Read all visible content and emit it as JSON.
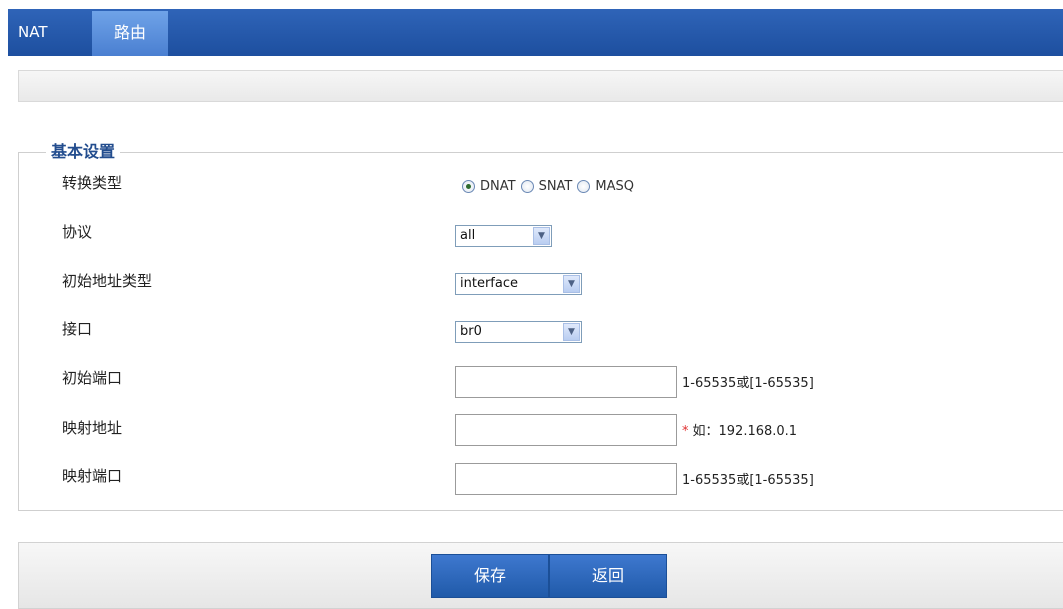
{
  "tabs": [
    {
      "label": "NAT",
      "active": false
    },
    {
      "label": "路由",
      "active": true
    }
  ],
  "section_title": "基本设置",
  "fields": {
    "conversion_type": {
      "label": "转换类型",
      "options": [
        "DNAT",
        "SNAT",
        "MASQ"
      ],
      "selected": "DNAT"
    },
    "protocol": {
      "label": "协议",
      "value": "all"
    },
    "initial_address_type": {
      "label": "初始地址类型",
      "value": "interface"
    },
    "interface": {
      "label": "接口",
      "value": "br0"
    },
    "initial_port": {
      "label": "初始端口",
      "value": "",
      "hint": "1-65535或[1-65535]"
    },
    "mapped_address": {
      "label": "映射地址",
      "value": "",
      "required_mark": "*",
      "hint": "如：192.168.0.1"
    },
    "mapped_port": {
      "label": "映射端口",
      "value": "",
      "hint": "1-65535或[1-65535]"
    }
  },
  "buttons": {
    "save": "保存",
    "back": "返回"
  },
  "colors": {
    "tab_bar": "#1d4f9f",
    "active_tab": "#5a8ddc",
    "button": "#2a64b8",
    "legend": "#234d8e",
    "required": "#e03030"
  }
}
